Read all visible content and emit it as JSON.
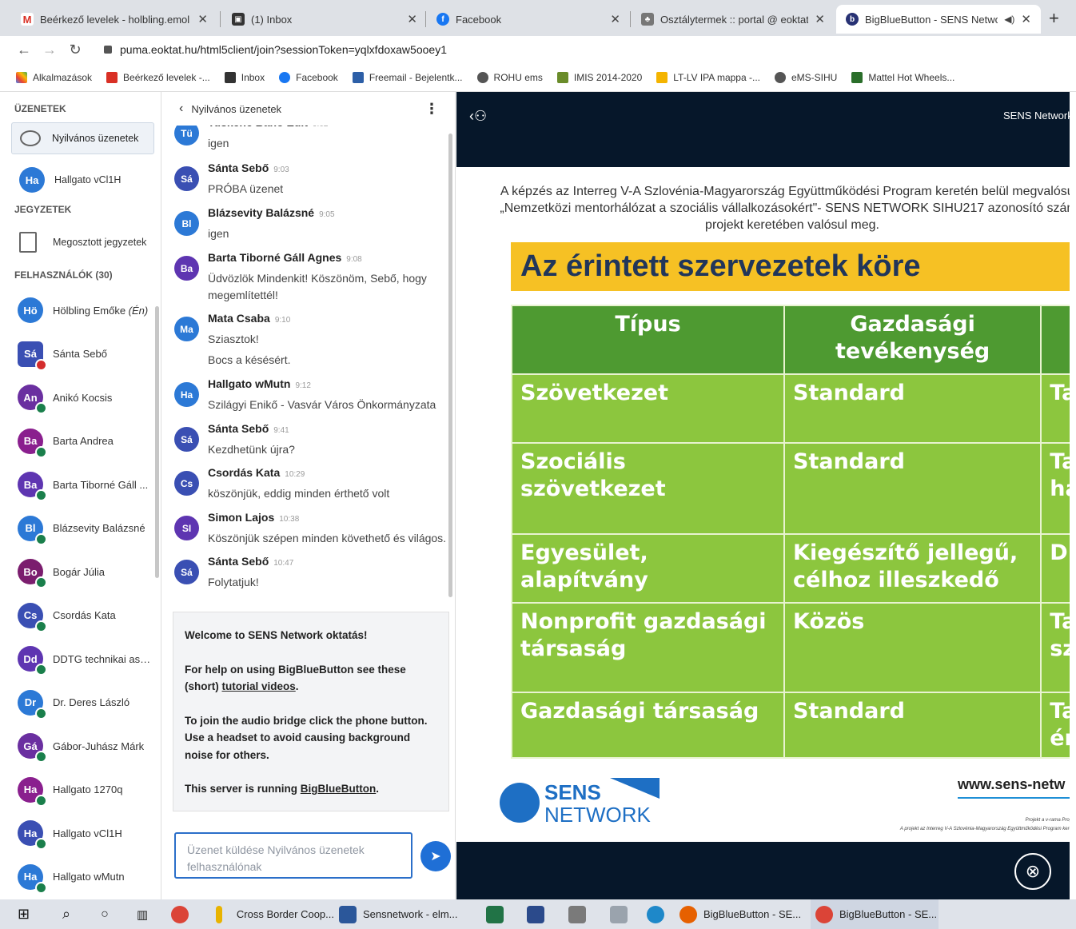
{
  "browser": {
    "tabs": [
      {
        "title": "Beérkező levelek - holbling.emol",
        "icon": "gmail-icon",
        "color": "#d93025"
      },
      {
        "title": "(1) Inbox",
        "icon": "inbox-icon",
        "color": "#333333"
      },
      {
        "title": "Facebook",
        "icon": "facebook-icon",
        "color": "#1877f2"
      },
      {
        "title": "Osztálytermek :: portal @ eoktat",
        "icon": "portal-icon",
        "color": "#555555"
      },
      {
        "title": "BigBlueButton - SENS Netwo",
        "icon": "bigbluebutton-icon",
        "color": "#283274",
        "active": true
      }
    ],
    "new_tab_label": "+",
    "url": "puma.eoktat.hu/html5client/join?sessionToken=yqlxfdoxaw5ooey1",
    "bookmarks": [
      {
        "label": "Alkalmazások",
        "color": "#4285f4"
      },
      {
        "label": "Beérkező levelek -...",
        "color": "#d93025"
      },
      {
        "label": "Inbox",
        "color": "#333333"
      },
      {
        "label": "Facebook",
        "color": "#1877f2"
      },
      {
        "label": "Freemail - Bejelentk...",
        "color": "#2d5fa7"
      },
      {
        "label": "ROHU ems",
        "color": "#555555"
      },
      {
        "label": "IMIS 2014-2020",
        "color": "#6a8c2a"
      },
      {
        "label": "LT-LV IPA mappa -...",
        "color": "#f4b400"
      },
      {
        "label": "eMS-SIHU",
        "color": "#555555"
      },
      {
        "label": "Mattel Hot Wheels...",
        "color": "#2a6e2a"
      }
    ]
  },
  "userlist": {
    "messages_header": "ÜZENETEK",
    "public_chat_label": "Nyilvános üzenetek",
    "private_chat": {
      "initials": "Ha",
      "name": "Hallgato vCl1H"
    },
    "notes_header": "JEGYZETEK",
    "shared_notes_label": "Megosztott jegyzetek",
    "users_header": "FELHASZNÁLÓK (30)",
    "users": [
      {
        "initials": "Hö",
        "name": "Hölbling Emőke",
        "you": "(Én)",
        "color": "#2c79d6",
        "status": "none"
      },
      {
        "initials": "Sá",
        "name": "Sánta Sebő",
        "color": "#3a4fb3",
        "status": "red",
        "square": true
      },
      {
        "initials": "An",
        "name": "Anikó Kocsis",
        "color": "#6a2fa0",
        "status": "green"
      },
      {
        "initials": "Ba",
        "name": "Barta Andrea",
        "color": "#8a1f8e",
        "status": "green"
      },
      {
        "initials": "Ba",
        "name": "Barta Tiborné Gáll ...",
        "color": "#5e35b1",
        "status": "green"
      },
      {
        "initials": "Bl",
        "name": "Blázsevity Balázsné",
        "color": "#2c79d6",
        "status": "green"
      },
      {
        "initials": "Bo",
        "name": "Bogár Júlia",
        "color": "#7b1d6e",
        "status": "green"
      },
      {
        "initials": "Cs",
        "name": "Csordás Kata",
        "color": "#3a4fb3",
        "status": "green"
      },
      {
        "initials": "Dd",
        "name": "DDTG technikai ass...",
        "color": "#5e35b1",
        "status": "green"
      },
      {
        "initials": "Dr",
        "name": "Dr. Deres László",
        "color": "#2c79d6",
        "status": "green"
      },
      {
        "initials": "Gá",
        "name": "Gábor-Juhász Márk",
        "color": "#6a2fa0",
        "status": "green"
      },
      {
        "initials": "Ha",
        "name": "Hallgato 1270q",
        "color": "#8a1f8e",
        "status": "green"
      },
      {
        "initials": "Ha",
        "name": "Hallgato vCl1H",
        "color": "#3a4fb3",
        "status": "green"
      },
      {
        "initials": "Ha",
        "name": "Hallgato wMutn",
        "color": "#2c79d6",
        "status": "green"
      }
    ]
  },
  "chat": {
    "back_label": "‹",
    "title": "Nyilvános üzenetek",
    "menu_label": "⋮",
    "messages": [
      {
        "initials": "Tü",
        "name": "Tuskene Bano Edit",
        "time": "9:02",
        "text": [
          "igen"
        ],
        "color": "#2c79d6"
      },
      {
        "initials": "Sá",
        "name": "Sánta Sebő",
        "time": "9:03",
        "text": [
          "PRÓBA üzenet"
        ],
        "color": "#3a4fb3"
      },
      {
        "initials": "Bl",
        "name": "Blázsevity Balázsné",
        "time": "9:05",
        "text": [
          "igen"
        ],
        "color": "#2c79d6"
      },
      {
        "initials": "Ba",
        "name": "Barta Tiborné Gáll Agnes",
        "time": "9:08",
        "text": [
          "Üdvözlök Mindenkit! Köszönöm, Sebő, hogy megemlítettél!"
        ],
        "color": "#5e35b1"
      },
      {
        "initials": "Ma",
        "name": "Mata Csaba",
        "time": "9:10",
        "text": [
          "Sziasztok!",
          "Bocs a késésért."
        ],
        "color": "#2c79d6"
      },
      {
        "initials": "Ha",
        "name": "Hallgato wMutn",
        "time": "9:12",
        "text": [
          "Szilágyi Enikő - Vasvár Város Önkormányzata"
        ],
        "color": "#2c79d6"
      },
      {
        "initials": "Sá",
        "name": "Sánta Sebő",
        "time": "9:41",
        "text": [
          "Kezdhetünk újra?"
        ],
        "color": "#3a4fb3"
      },
      {
        "initials": "Cs",
        "name": "Csordás Kata",
        "time": "10:29",
        "text": [
          "köszönjük, eddig minden érthető volt"
        ],
        "color": "#3a4fb3"
      },
      {
        "initials": "SI",
        "name": "Simon Lajos",
        "time": "10:38",
        "text": [
          "Köszönjük szépen minden követhető és világos."
        ],
        "color": "#5e35b1"
      },
      {
        "initials": "Sá",
        "name": "Sánta Sebő",
        "time": "10:47",
        "text": [
          "Folytatjuk!"
        ],
        "color": "#3a4fb3"
      }
    ],
    "welcome": {
      "line1": "Welcome to SENS Network oktatás!",
      "line2_pre": "For help on using BigBlueButton see these (short) ",
      "line2_link": "tutorial videos",
      "line2_post": ".",
      "line3": "To join the audio bridge click the phone button. Use a headset to avoid causing background noise for others.",
      "line4_pre": "This server is running ",
      "line4_link": "BigBlueButton",
      "line4_post": "."
    },
    "input_placeholder": "Üzenet küldése Nyilvános üzenetek felhasználónak"
  },
  "presentation": {
    "header_label": "SENS Network",
    "intro": "A képzés az Interreg V-A Szlovénia-Magyarország Együttműködési Program keretén belül megvalósuló „Nemzetközi mentorhálózat a szociális vállalkozásokért\"- SENS NETWORK SIHU217 azonosító számú projekt keretében valósul meg.",
    "title": "Az érintett szervezetek köre",
    "table_header": [
      "Típus",
      "Gazdasági tevékenység",
      ""
    ],
    "table_rows": [
      [
        "Szövetkezet",
        "Standard",
        "Ta ja"
      ],
      [
        "Szociális szövetkezet",
        "Standard",
        "Ta ja ha"
      ],
      [
        "Egyesület, alapítvány",
        "Kiegészítő jellegű, célhoz illeszkedő",
        "D ér"
      ],
      [
        "Nonprofit gazdasági társaság",
        "Közös",
        "Ta sz ki"
      ],
      [
        "Gazdasági társaság",
        "Standard",
        "Ta ér"
      ]
    ],
    "website": "www.sens-netw",
    "logo_line1": "SENS",
    "logo_line2": "NETWORK",
    "fineprint1": "Projekt a v-rama Programja...",
    "fineprint2": "A projekt az Interreg V-A Szlovénia-Magyarország Együttműködési Program keretében..."
  },
  "taskbar": {
    "items": [
      {
        "label": "Cross Border Coop...",
        "color": "#e8b300"
      },
      {
        "label": "Sensnetwork - elm...",
        "color": "#2b579a"
      },
      {
        "label": "BigBlueButton - SE...",
        "color": "#e66000"
      },
      {
        "label": "BigBlueButton - SE...",
        "color": "#db4437"
      }
    ]
  }
}
